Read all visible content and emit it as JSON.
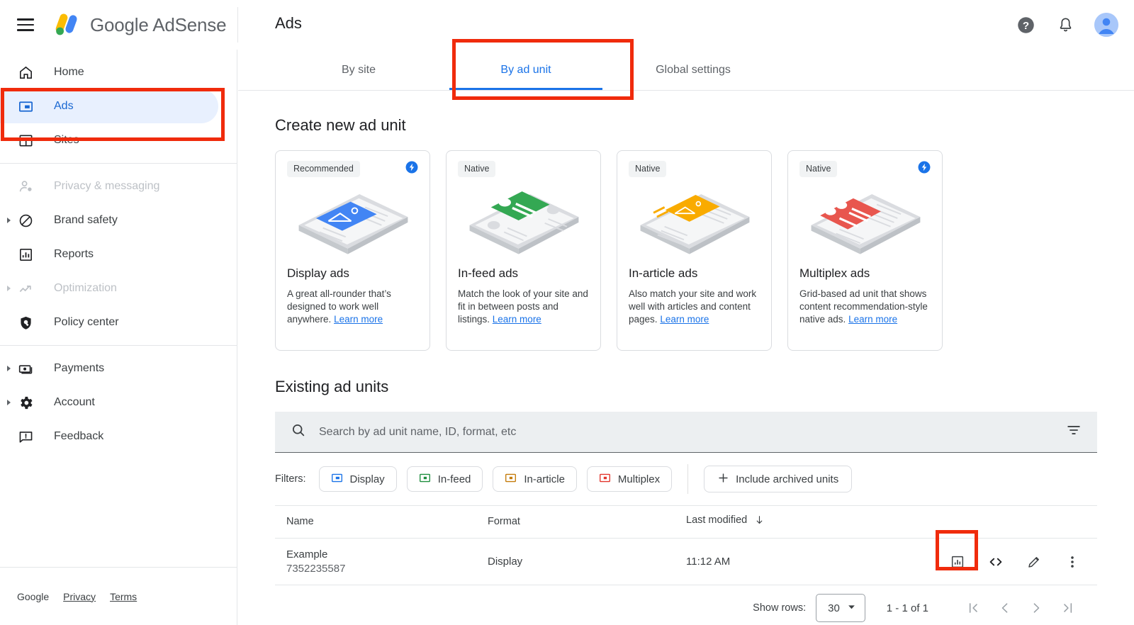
{
  "brand": {
    "name": "Google AdSense",
    "menu_icon": "hamburger-icon",
    "logo_icon": "adsense-logo-icon"
  },
  "header": {
    "page_title": "Ads",
    "help_icon": "help-icon",
    "notifications_icon": "bell-icon",
    "avatar_icon": "account-avatar"
  },
  "sidebar": {
    "groups": [
      {
        "items": [
          {
            "label": "Home",
            "icon": "home-icon",
            "state": "default",
            "expandable": false
          },
          {
            "label": "Ads",
            "icon": "ads-icon",
            "state": "active",
            "expandable": false
          },
          {
            "label": "Sites",
            "icon": "sites-icon",
            "state": "default",
            "expandable": false
          }
        ]
      },
      {
        "items": [
          {
            "label": "Privacy & messaging",
            "icon": "privacy-person-icon",
            "state": "disabled",
            "expandable": false
          },
          {
            "label": "Brand safety",
            "icon": "block-circle-icon",
            "state": "default",
            "expandable": true
          },
          {
            "label": "Reports",
            "icon": "bar-chart-icon",
            "state": "default",
            "expandable": false
          },
          {
            "label": "Optimization",
            "icon": "trending-up-icon",
            "state": "disabled",
            "expandable": true
          },
          {
            "label": "Policy center",
            "icon": "shield-icon",
            "state": "default",
            "expandable": false
          }
        ]
      },
      {
        "items": [
          {
            "label": "Payments",
            "icon": "money-icon",
            "state": "default",
            "expandable": true
          },
          {
            "label": "Account",
            "icon": "gear-icon",
            "state": "default",
            "expandable": true
          },
          {
            "label": "Feedback",
            "icon": "feedback-icon",
            "state": "default",
            "expandable": false
          }
        ]
      }
    ],
    "footer": {
      "google": "Google",
      "privacy": "Privacy",
      "terms": "Terms"
    }
  },
  "tabs": [
    {
      "label": "By site",
      "active": false
    },
    {
      "label": "By ad unit",
      "active": true
    },
    {
      "label": "Global settings",
      "active": false
    }
  ],
  "create_section": {
    "title": "Create new ad unit",
    "cards": [
      {
        "badge": "Recommended",
        "has_bolt": true,
        "title": "Display ads",
        "desc": "A great all-rounder that’s designed to work well anywhere.",
        "link": "Learn more",
        "art_color": "#4285f4",
        "art_icon": "display-ad-illustration"
      },
      {
        "badge": "Native",
        "has_bolt": false,
        "title": "In-feed ads",
        "desc": "Match the look of your site and fit in between posts and listings.",
        "link": "Learn more",
        "art_color": "#34a853",
        "art_icon": "in-feed-ad-illustration"
      },
      {
        "badge": "Native",
        "has_bolt": false,
        "title": "In-article ads",
        "desc": "Also match your site and work well with articles and content pages.",
        "link": "Learn more",
        "art_color": "#f9ab00",
        "art_icon": "in-article-ad-illustration"
      },
      {
        "badge": "Native",
        "has_bolt": true,
        "title": "Multiplex ads",
        "desc": "Grid-based ad unit that shows content recommendation-style native ads.",
        "link": "Learn more",
        "art_color": "#e8564e",
        "art_icon": "multiplex-ad-illustration"
      }
    ]
  },
  "existing_section": {
    "title": "Existing ad units",
    "search": {
      "placeholder": "Search by ad unit name, ID, format, etc",
      "value": "",
      "icon": "search-icon",
      "filter_icon": "tune-icon"
    },
    "filters_label": "Filters:",
    "filter_chips": [
      {
        "label": "Display",
        "color": "#1a73e8",
        "icon": "display-format-icon"
      },
      {
        "label": "In-feed",
        "color": "#1e8e3e",
        "icon": "in-feed-format-icon"
      },
      {
        "label": "In-article",
        "color": "#c47b0a",
        "icon": "in-article-format-icon"
      },
      {
        "label": "Multiplex",
        "color": "#e2352c",
        "icon": "multiplex-format-icon"
      }
    ],
    "include_archived": {
      "label": "Include archived units",
      "icon": "plus-icon"
    },
    "table": {
      "columns": [
        {
          "label": "Name"
        },
        {
          "label": "Format"
        },
        {
          "label": "Last modified",
          "sort": "descending",
          "sort_icon": "arrow-down-icon"
        }
      ],
      "rows": [
        {
          "name": "Example",
          "id": "7352235587",
          "format": "Display",
          "last_modified": "11:12 AM",
          "actions": [
            {
              "icon": "report-chart-icon",
              "name": "view-report-button"
            },
            {
              "icon": "code-icon",
              "name": "get-code-button"
            },
            {
              "icon": "pencil-icon",
              "name": "edit-button"
            },
            {
              "icon": "more-vert-icon",
              "name": "more-options-button"
            }
          ]
        }
      ]
    },
    "pagination": {
      "show_rows_label": "Show rows:",
      "rows_per_page": "30",
      "range": "1 - 1 of 1",
      "first_icon": "first-page-icon",
      "prev_icon": "prev-page-icon",
      "next_icon": "next-page-icon",
      "last_icon": "last-page-icon"
    }
  },
  "annotations": {
    "color": "#f02b0c",
    "boxes": [
      {
        "name": "highlight-sidebar-ads"
      },
      {
        "name": "highlight-tab-by-ad-unit"
      },
      {
        "name": "highlight-get-code-action"
      }
    ]
  }
}
